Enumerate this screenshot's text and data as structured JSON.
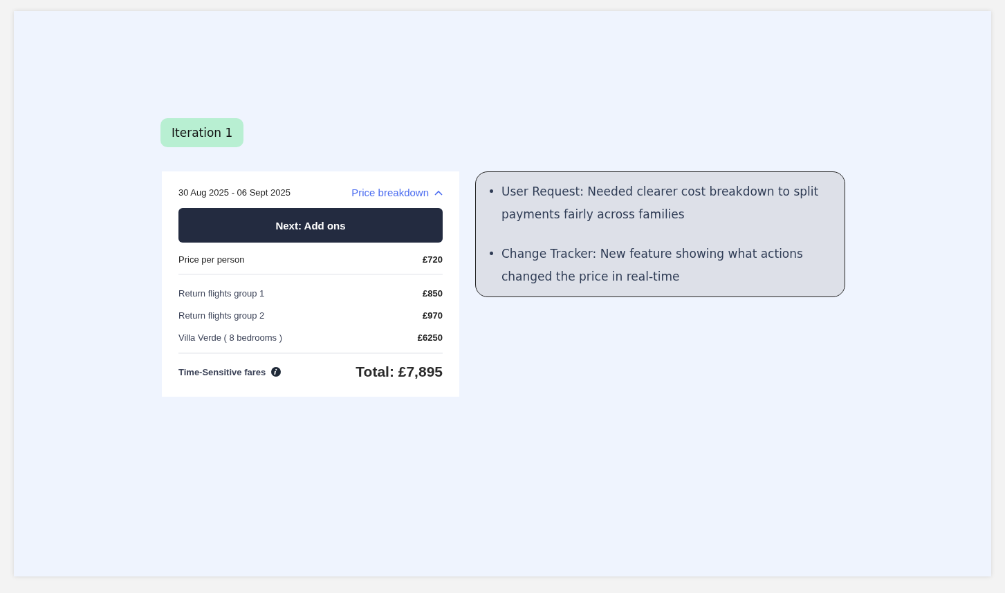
{
  "badge": {
    "label": "Iteration 1"
  },
  "card": {
    "dates": "30 Aug 2025 - 06 Sept 2025",
    "breakdown_link": {
      "label": "Price breakdown",
      "expanded": true
    },
    "next_button": "Next: Add ons",
    "price_per_person": {
      "label": "Price per person",
      "amount": "£720"
    },
    "items": [
      {
        "label": "Return flights group 1",
        "amount": "£850"
      },
      {
        "label": "Return flights group 2",
        "amount": "£970"
      },
      {
        "label": "Villa Verde ( 8 bedrooms )",
        "amount": "£6250"
      }
    ],
    "fares_note": "Time-Sensitive fares",
    "total": "Total: £7,895"
  },
  "notes": [
    "User Request: Needed clearer cost breakdown to split payments fairly across families",
    "Change Tracker: New feature showing what actions changed the price in real-time"
  ]
}
